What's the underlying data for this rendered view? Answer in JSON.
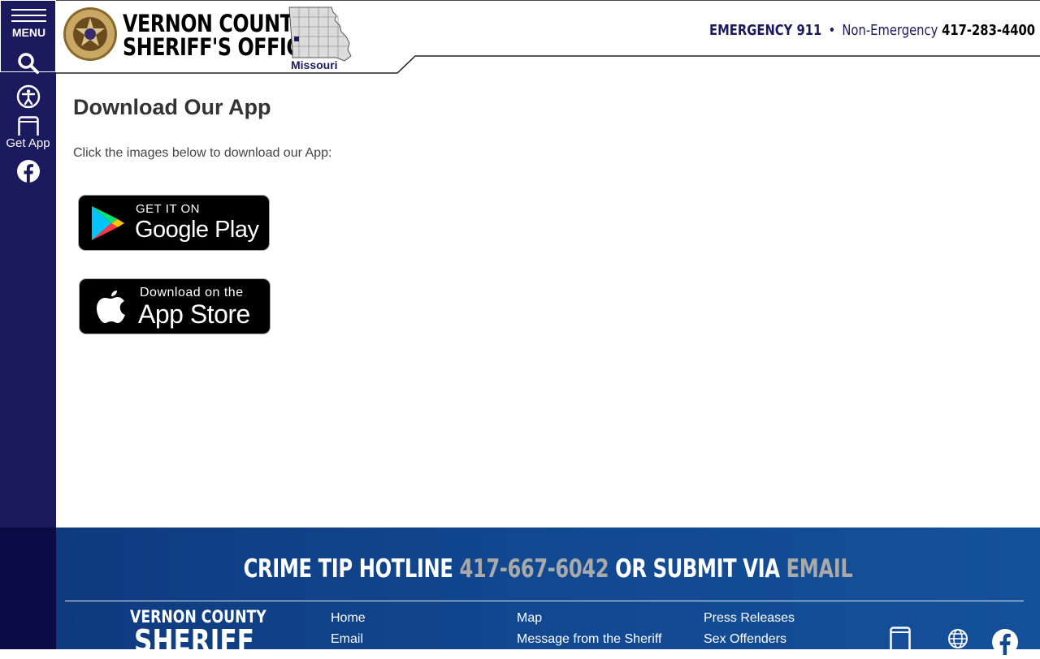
{
  "rail": {
    "menu_label": "MENU",
    "get_app_label": "Get App",
    "icons": [
      "menu-icon",
      "search-icon",
      "accessibility-icon",
      "phone-icon",
      "facebook-icon"
    ]
  },
  "header": {
    "brand_line1": "VERNON COUNTY",
    "brand_line2": "SHERIFF'S OFFICE",
    "state": "Missouri",
    "emergency_label": "EMERGENCY 911",
    "separator": "•",
    "nonemergency_label": "Non-Emergency",
    "nonemergency_phone": "417-283-4400"
  },
  "main": {
    "title": "Download Our App",
    "intro": "Click the images below to download our App:",
    "google_play": {
      "top": "GET IT ON",
      "big": "Google Play"
    },
    "app_store": {
      "top": "Download on the",
      "big": "App Store"
    }
  },
  "footer": {
    "hotline_prefix": "CRIME TIP HOTLINE",
    "hotline_phone": "417-667-6042",
    "hotline_middle": "OR SUBMIT VIA",
    "hotline_email": "EMAIL",
    "brand_line1": "VERNON COUNTY",
    "brand_line2": "SHERIFF",
    "links_col1": [
      "Home",
      "Email"
    ],
    "links_col2": [
      "Map",
      "Message from the Sheriff"
    ],
    "links_col3": [
      "Press Releases",
      "Sex Offenders"
    ],
    "icons": [
      "phone-icon",
      "globe-icon",
      "facebook-icon"
    ]
  },
  "colors": {
    "rail": "#1c1a5e",
    "footer": "#114a92",
    "hotline_highlight": "#a9a9a9"
  }
}
